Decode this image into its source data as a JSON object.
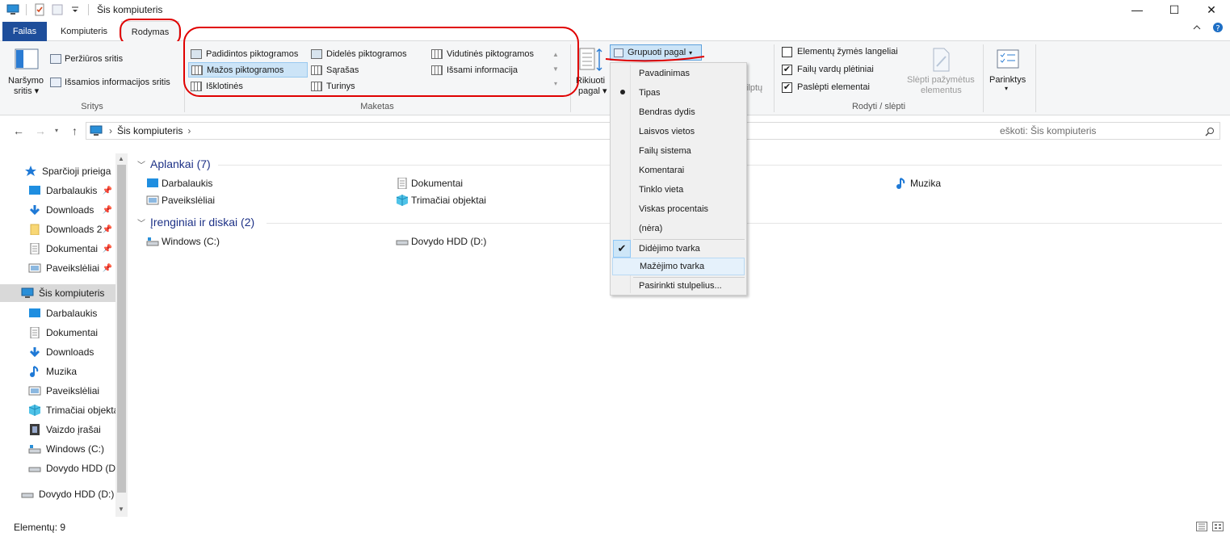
{
  "window": {
    "title": "Šis kompiuteris",
    "controls": {
      "minimize": "—",
      "maximize": "☐",
      "close": "✕"
    }
  },
  "ribbon_tabs": {
    "file": "Failas",
    "computer": "Kompiuteris",
    "view": "Rodymas"
  },
  "ribbon": {
    "panes": {
      "nav_pane_line1": "Naršymo",
      "nav_pane_line2": "sritis",
      "preview_pane": "Peržiūros sritis",
      "details_pane": "Išsamios informacijos sritis",
      "label": "Sritys"
    },
    "layout": {
      "items": [
        "Padidintos piktogramos",
        "Didelės piktogramos",
        "Vidutinės piktogramos",
        "Mažos piktogramos",
        "Sąrašas",
        "Išsami informacija",
        "Išklotinės",
        "Turinys"
      ],
      "selected": "Mažos piktogramos",
      "label": "Maketas"
    },
    "current_view": {
      "sort_line1": "Rikiuoti",
      "sort_line2": "pagal",
      "group_by": "Grupuoti pagal",
      "hidden_tail": "ilptų"
    },
    "show_hide": {
      "item_checkboxes": "Elementų žymės langeliai",
      "file_extensions": "Failų vardų plėtiniai",
      "hidden_items": "Paslėpti elementai",
      "hide_selected_line1": "Slėpti pažymėtus",
      "hide_selected_line2": "elementus",
      "label": "Rodyti / slėpti",
      "item_checkboxes_checked": false,
      "file_extensions_checked": true,
      "hidden_items_checked": true
    },
    "options": "Parinktys"
  },
  "address": {
    "path": "Šis kompiuteris",
    "search_placeholder": "eškoti: Šis kompiuteris"
  },
  "nav_pane": {
    "items": [
      {
        "label": "Sparčioji prieiga",
        "pinned": false
      },
      {
        "label": "Darbalaukis",
        "pinned": true
      },
      {
        "label": "Downloads",
        "pinned": true
      },
      {
        "label": "Downloads 2",
        "pinned": true
      },
      {
        "label": "Dokumentai",
        "pinned": true
      },
      {
        "label": "Paveikslėliai",
        "pinned": true
      },
      {
        "label": "Šis kompiuteris",
        "pinned": false
      },
      {
        "label": "Darbalaukis",
        "pinned": false
      },
      {
        "label": "Dokumentai",
        "pinned": false
      },
      {
        "label": "Downloads",
        "pinned": false
      },
      {
        "label": "Muzika",
        "pinned": false
      },
      {
        "label": "Paveikslėliai",
        "pinned": false
      },
      {
        "label": "Trimačiai objekta",
        "pinned": false
      },
      {
        "label": "Vaizdo įrašai",
        "pinned": false
      },
      {
        "label": "Windows (C:)",
        "pinned": false
      },
      {
        "label": "Dovydo HDD (D:",
        "pinned": false
      },
      {
        "label": "Dovydo HDD (D:)",
        "pinned": false
      }
    ]
  },
  "content": {
    "folders_header": "Aplankai (7)",
    "devices_header": "Įrenginiai ir diskai (2)",
    "folders": [
      "Darbalaukis",
      "Dokumentai",
      "Muzika",
      "Paveikslėliai",
      "Trimačiai objektai"
    ],
    "devices": [
      "Windows (C:)",
      "Dovydo HDD (D:)"
    ]
  },
  "group_menu": {
    "items": [
      "Pavadinimas",
      "Tipas",
      "Bendras dydis",
      "Laisvos vietos",
      "Failų sistema",
      "Komentarai",
      "Tinklo vieta",
      "Viskas procentais",
      "(nėra)",
      "Didėjimo tvarka",
      "Mažėjimo tvarka",
      "Pasirinkti stulpelius..."
    ],
    "bullet_item": "Tipas",
    "checked_item": "Didėjimo tvarka",
    "hover_item": "Mažėjimo tvarka"
  },
  "status": {
    "count": "Elementų: 9"
  },
  "colors": {
    "file_tab": "#1e4e9b",
    "annotation_red": "#e00000",
    "selection": "#cce4f7"
  }
}
